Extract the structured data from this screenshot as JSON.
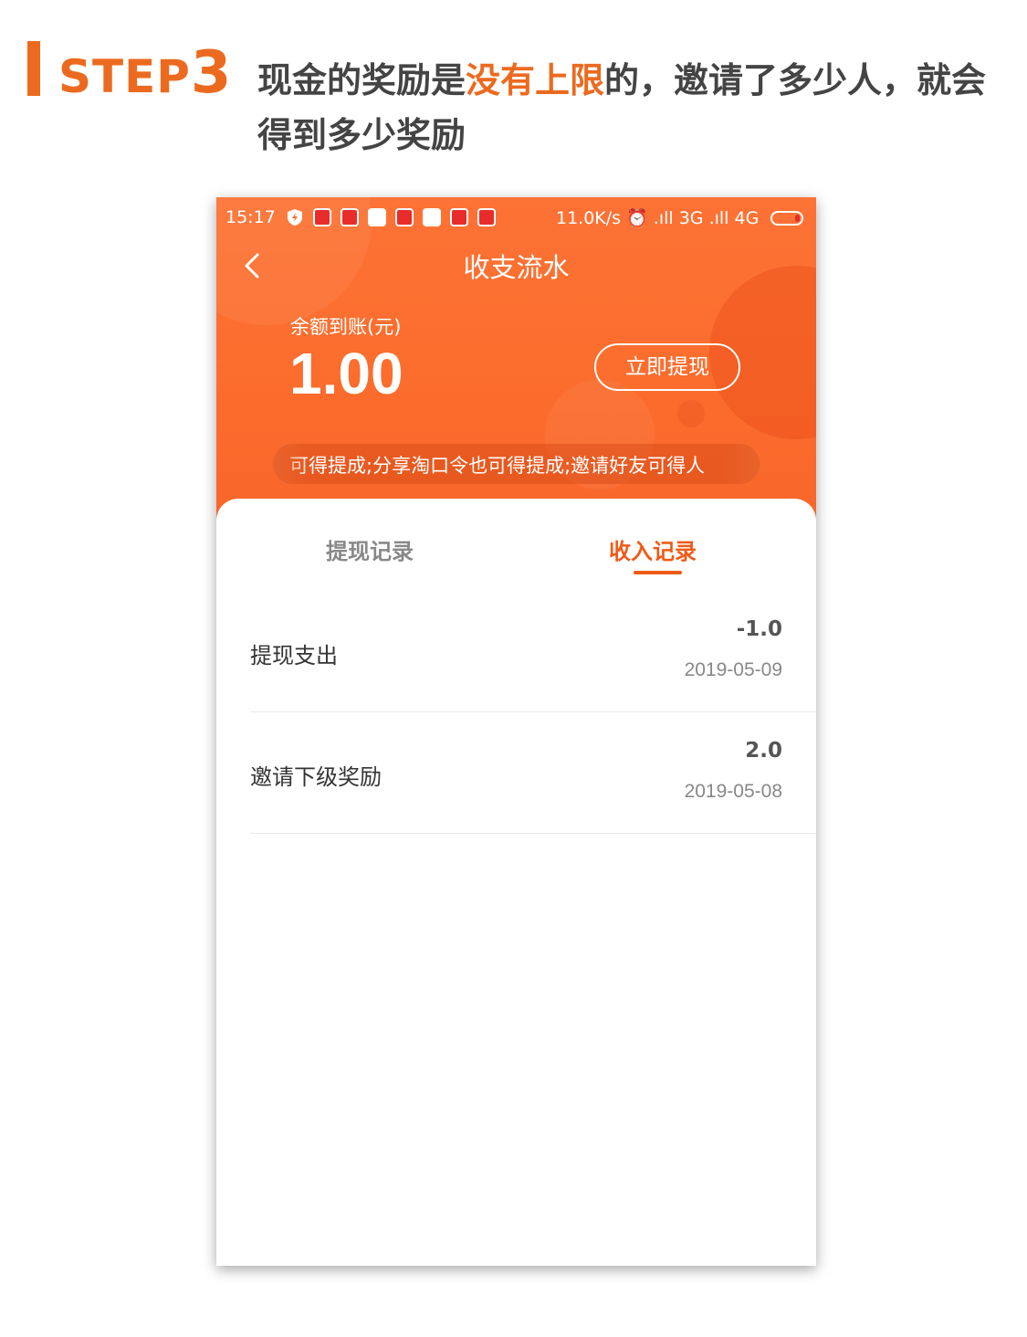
{
  "heading": {
    "step_word": "STEP",
    "step_number": "3",
    "text_before": "现金的奖励是",
    "text_highlight": "没有上限",
    "text_after": "的，邀请了多少人，就会得到多少奖励"
  },
  "statusbar": {
    "time": "15:17",
    "network": "11.0K/s ⏰ .ıll 3G .ıll 4G"
  },
  "navbar": {
    "title": "收支流水"
  },
  "balance": {
    "label": "余额到账(元)",
    "value": "1.00",
    "withdraw_label": "立即提现"
  },
  "notice": {
    "text": "可得提成;分享淘口令也可得提成;邀请好友可得人"
  },
  "tabs": [
    {
      "label": "提现记录",
      "active": false
    },
    {
      "label": "收入记录",
      "active": true
    }
  ],
  "records": [
    {
      "title": "提现支出",
      "amount": "-1.0",
      "date": "2019-05-09"
    },
    {
      "title": "邀请下级奖励",
      "amount": "2.0",
      "date": "2019-05-08"
    }
  ],
  "colors": {
    "accent": "#ec6a1f",
    "hero": "#fb6c2c",
    "tab_active": "#ef5a18"
  }
}
